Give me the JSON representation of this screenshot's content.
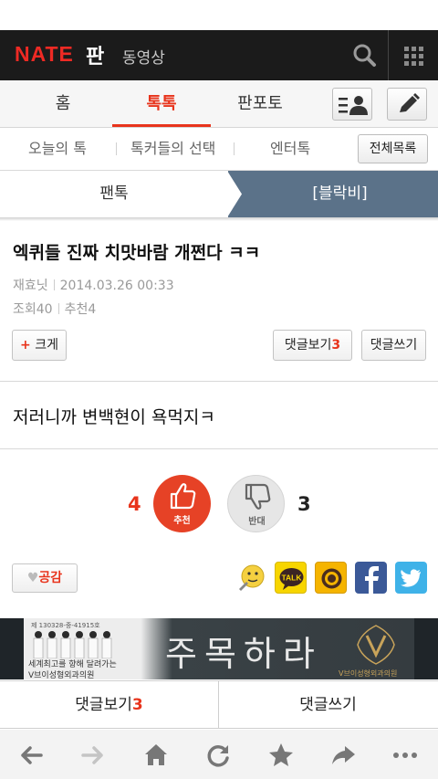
{
  "header": {
    "logo_nate": "NATE",
    "logo_pan": "판",
    "section": "동영상"
  },
  "tabs": [
    {
      "label": "홈"
    },
    {
      "label": "톡톡",
      "active": true
    },
    {
      "label": "판포토"
    }
  ],
  "subnav": {
    "items": [
      "오늘의 톡",
      "톡커들의 선택",
      "엔터톡"
    ],
    "all_button": "전체목록"
  },
  "category": {
    "left": "팬톡",
    "right": "[블락비]"
  },
  "article": {
    "title": "엑퀴들 진짜 치맛바람 개쩐다 ㅋㅋ",
    "author": "재효닛",
    "date": "2014.03.26 00:33",
    "views_label": "조회",
    "views": "40",
    "recommend_label": "추천",
    "recommend": "4",
    "body": "저러니까 변백현이 욕먹지ㅋ"
  },
  "buttons": {
    "bigger_plus": "+",
    "bigger": "크게",
    "view_comments": "댓글보기",
    "comment_count": "3",
    "write_comment": "댓글쓰기"
  },
  "votes": {
    "up_count": "4",
    "up_label": "추천",
    "down_count": "3",
    "down_label": "반대"
  },
  "share": {
    "like_label": "공감",
    "icons": [
      "emoticon-icon",
      "kakaotalk-icon",
      "kakaostory-icon",
      "facebook-icon",
      "twitter-icon"
    ],
    "talk_text": "TALK"
  },
  "ad": {
    "small": "제 130328-중-41915호",
    "line1": "세계최고를 향해 달려가는",
    "line2": "V브이성형외과의원",
    "headline": "주목하라",
    "brand": "V브이성형외과의원"
  },
  "comment_bar": {
    "view_label": "댓글보기",
    "view_count": "3",
    "write_label": "댓글쓰기"
  },
  "colors": {
    "accent": "#e8341c",
    "header_bg": "#1b1b1b",
    "category_bg": "#5b7289"
  }
}
